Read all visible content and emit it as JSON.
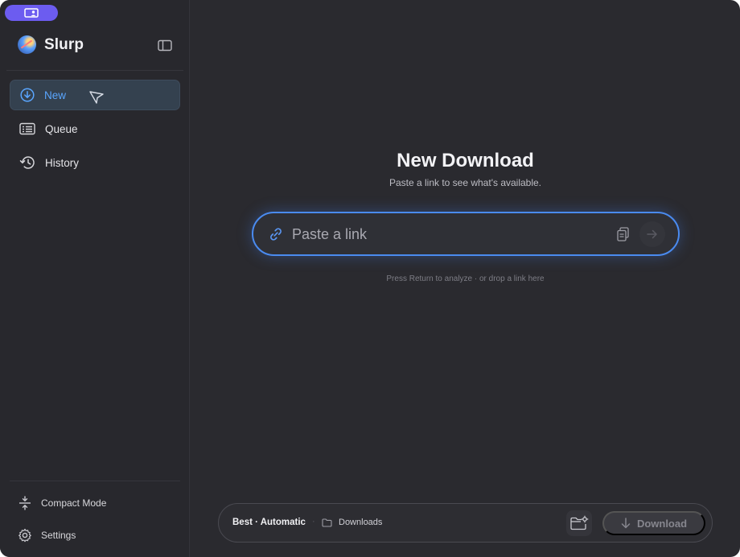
{
  "app": {
    "name": "Slurp",
    "accent_color": "#4a8bf0",
    "top_pill_color": "#6c5cf0"
  },
  "sidebar": {
    "items": [
      {
        "label": "New",
        "icon": "download-circle-icon",
        "active": true
      },
      {
        "label": "Queue",
        "icon": "queue-list-icon",
        "active": false
      },
      {
        "label": "History",
        "icon": "history-clock-icon",
        "active": false
      }
    ],
    "footer": [
      {
        "label": "Compact Mode",
        "icon": "compact-mode-icon"
      },
      {
        "label": "Settings",
        "icon": "gear-icon"
      }
    ]
  },
  "main": {
    "title": "New Download",
    "subtitle": "Paste a link to see what's available.",
    "link_input": {
      "placeholder": "Paste a link",
      "value": ""
    },
    "hint": "Press Return to analyze · or drop a link here"
  },
  "bottom_bar": {
    "quality": "Best · Automatic",
    "separator": "·",
    "folder": "Downloads",
    "download_label": "Download"
  }
}
